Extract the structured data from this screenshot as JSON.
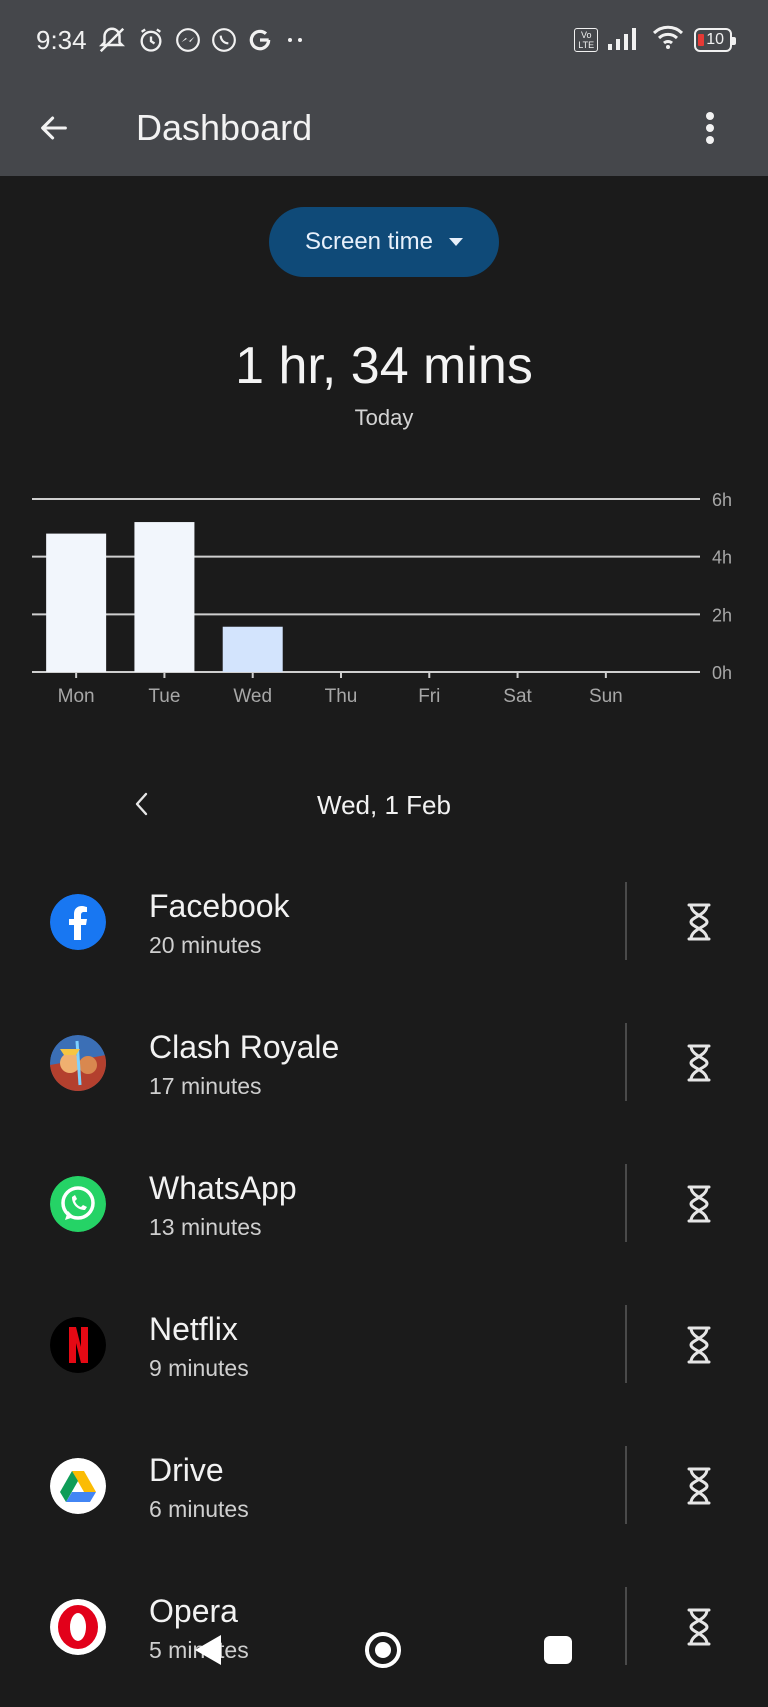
{
  "status_bar": {
    "time": "9:34",
    "left_icons": [
      "bell-off-icon",
      "alarm-icon",
      "messenger-icon",
      "whatsapp-icon",
      "google-icon",
      "more-dots-icon"
    ],
    "network_badge": "Vo LTE",
    "battery": "10"
  },
  "app_bar": {
    "title": "Dashboard",
    "back_icon": "arrow-left-icon",
    "menu_icon": "more-vert-icon"
  },
  "metric_selector": {
    "label": "Screen time",
    "icon": "dropdown-icon"
  },
  "summary": {
    "total": "1 hr, 34 mins",
    "period": "Today"
  },
  "chart_data": {
    "type": "bar",
    "categories": [
      "Mon",
      "Tue",
      "Wed",
      "Thu",
      "Fri",
      "Sat",
      "Sun"
    ],
    "values": [
      4.8,
      5.2,
      1.57,
      0,
      0,
      0,
      0
    ],
    "y_ticks": [
      "0h",
      "2h",
      "4h",
      "6h"
    ],
    "ylim": [
      0,
      6
    ],
    "selected_index": 2,
    "grid": true,
    "colors": {
      "bar": "#f2f6fc",
      "selected": "#d3e4fd",
      "grid": "#cfcfcf",
      "label": "#a7a7a7"
    }
  },
  "date_nav": {
    "label": "Wed, 1 Feb",
    "prev_icon": "chevron-left-icon"
  },
  "apps": [
    {
      "name": "Facebook",
      "time": "20 minutes",
      "icon": "facebook-icon"
    },
    {
      "name": "Clash Royale",
      "time": "17 minutes",
      "icon": "clash-royale-icon"
    },
    {
      "name": "WhatsApp",
      "time": "13 minutes",
      "icon": "whatsapp-icon"
    },
    {
      "name": "Netflix",
      "time": "9 minutes",
      "icon": "netflix-icon"
    },
    {
      "name": "Drive",
      "time": "6 minutes",
      "icon": "drive-icon"
    },
    {
      "name": "Opera",
      "time": "5 minutes",
      "icon": "opera-icon"
    }
  ],
  "nav_bar": [
    "back-triangle-icon",
    "home-circle-icon",
    "recents-square-icon"
  ]
}
